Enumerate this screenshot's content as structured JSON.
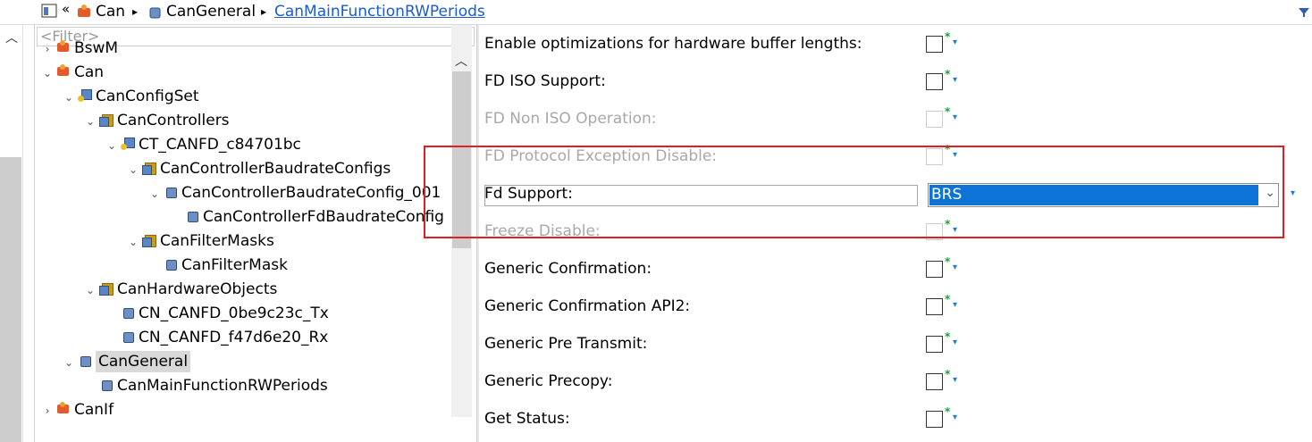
{
  "breadcrumb": {
    "back_glyph": "«",
    "items": [
      "Can",
      "CanGeneral"
    ],
    "current": "CanMainFunctionRWPeriods",
    "separator": "▸"
  },
  "tree": {
    "filter_placeholder": "<Filter>",
    "nodes": [
      {
        "label": "BswM",
        "expander": "›",
        "icon": "module-icon"
      },
      {
        "label": "Can",
        "expander": "⌄",
        "icon": "module-icon"
      },
      {
        "label": "CanConfigSet",
        "expander": "⌄",
        "icon": "config-icon"
      },
      {
        "label": "CanControllers",
        "expander": "⌄",
        "icon": "container-icon"
      },
      {
        "label": "CT_CANFD_c84701bc",
        "expander": "⌄",
        "icon": "config-icon"
      },
      {
        "label": "CanControllerBaudrateConfigs",
        "expander": "⌄",
        "icon": "container-icon"
      },
      {
        "label": "CanControllerBaudrateConfig_001",
        "expander": "⌄",
        "icon": "leaf-icon"
      },
      {
        "label": "CanControllerFdBaudrateConfig",
        "expander": "",
        "icon": "leaf-icon"
      },
      {
        "label": "CanFilterMasks",
        "expander": "⌄",
        "icon": "container-icon"
      },
      {
        "label": "CanFilterMask",
        "expander": "",
        "icon": "leaf-icon"
      },
      {
        "label": "CanHardwareObjects",
        "expander": "⌄",
        "icon": "container-icon"
      },
      {
        "label": "CN_CANFD_0be9c23c_Tx",
        "expander": "",
        "icon": "leaf-icon"
      },
      {
        "label": "CN_CANFD_f47d6e20_Rx",
        "expander": "",
        "icon": "leaf-icon"
      },
      {
        "label": "CanGeneral",
        "expander": "⌄",
        "icon": "leaf-icon"
      },
      {
        "label": "CanMainFunctionRWPeriods",
        "expander": "",
        "icon": "leaf-icon"
      },
      {
        "label": "CanIf",
        "expander": "›",
        "icon": "module-icon"
      }
    ]
  },
  "properties": {
    "rows": [
      {
        "label": "Enable optimizations for hardware buffer lengths:",
        "enabled": true,
        "checked": false
      },
      {
        "label": "FD ISO Support:",
        "enabled": true,
        "checked": false
      },
      {
        "label": "FD Non ISO Operation:",
        "enabled": false,
        "checked": false
      },
      {
        "label": "FD Protocol Exception Disable:",
        "enabled": false,
        "checked": false
      },
      {
        "label": "Fd Support:",
        "type": "select",
        "value": "BRS"
      },
      {
        "label": "Freeze Disable:",
        "enabled": false,
        "checked": false
      },
      {
        "label": "Generic Confirmation:",
        "enabled": true,
        "checked": false
      },
      {
        "label": "Generic Confirmation API2:",
        "enabled": true,
        "checked": false
      },
      {
        "label": "Generic Pre Transmit:",
        "enabled": true,
        "checked": false
      },
      {
        "label": "Generic Precopy:",
        "enabled": true,
        "checked": false
      },
      {
        "label": "Get Status:",
        "enabled": true,
        "checked": false
      }
    ],
    "star": "*",
    "dropdown_glyph": "▾",
    "select_chevron": "⌄"
  },
  "colors": {
    "selection_blue": "#0d73d6",
    "highlight_red": "#e02020",
    "link_blue": "#1a5ccc",
    "star_green": "#1e9b3c"
  }
}
